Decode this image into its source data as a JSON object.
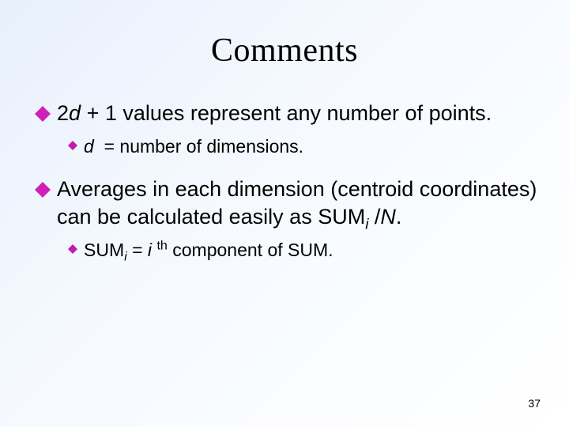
{
  "title": "Comments",
  "bullets": [
    {
      "html": "2<span class='italic'>d</span> + 1 values represent any number of points.",
      "sub": [
        {
          "html": "<span class='italic'>d </span>&nbsp;= number of dimensions."
        }
      ]
    },
    {
      "html": "Averages in each dimension (centroid coordinates) can be calculated easily as SUM<span class='sub'>i</span> /<span class='italic'>N</span>.",
      "sub": [
        {
          "html": "SUM<span class='sub'>i</span> = <span class='italic'>i</span> <span class='sup'>th</span> component of SUM."
        }
      ]
    }
  ],
  "pageNumber": "37",
  "colors": {
    "diamond": "#d11fb9",
    "miniDiamond": "#c41aa8"
  }
}
